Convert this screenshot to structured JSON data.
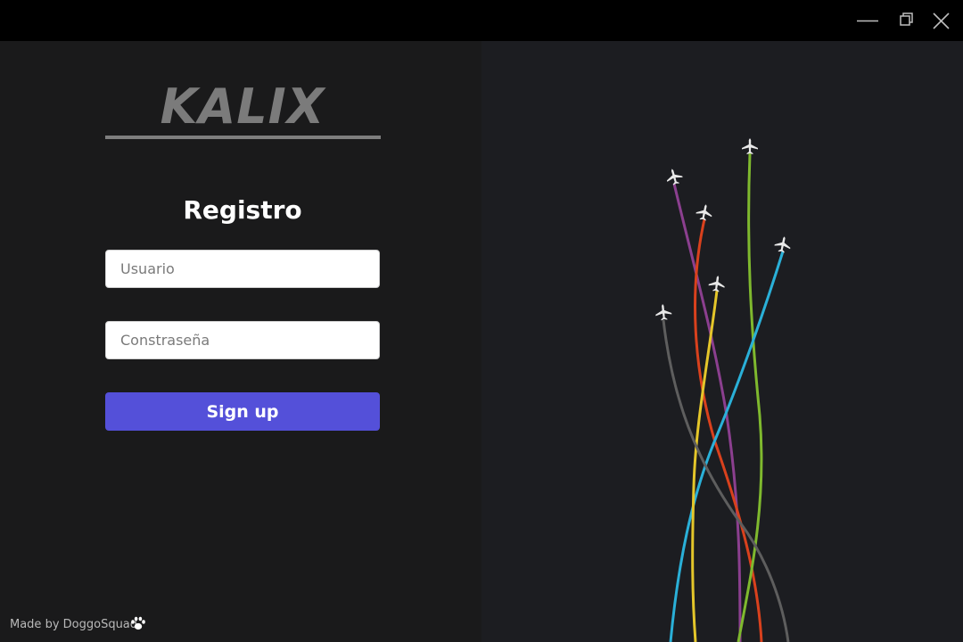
{
  "window": {
    "minimize_icon": "minimize-icon",
    "maximize_icon": "restore-icon",
    "close_icon": "close-icon"
  },
  "brand": {
    "logo_text": "KALIX"
  },
  "form": {
    "title": "Registro",
    "username_placeholder": "Usuario",
    "password_placeholder": "Constraseña",
    "signup_label": "Sign up"
  },
  "footer": {
    "credit": "Made by DoggoSquad",
    "icon": "paw-icon"
  },
  "colors": {
    "accent": "#5450d9",
    "left_bg": "#1a1a1b",
    "right_bg": "#1c1d21",
    "trails": [
      "#8b3f8f",
      "#d9411d",
      "#7fb92e",
      "#2ab0d8",
      "#e4c62a",
      "#6a6a6a"
    ]
  },
  "illustration": {
    "subject": "airplanes-with-colored-trails",
    "plane_icon": "airplane-icon",
    "count": 6
  }
}
